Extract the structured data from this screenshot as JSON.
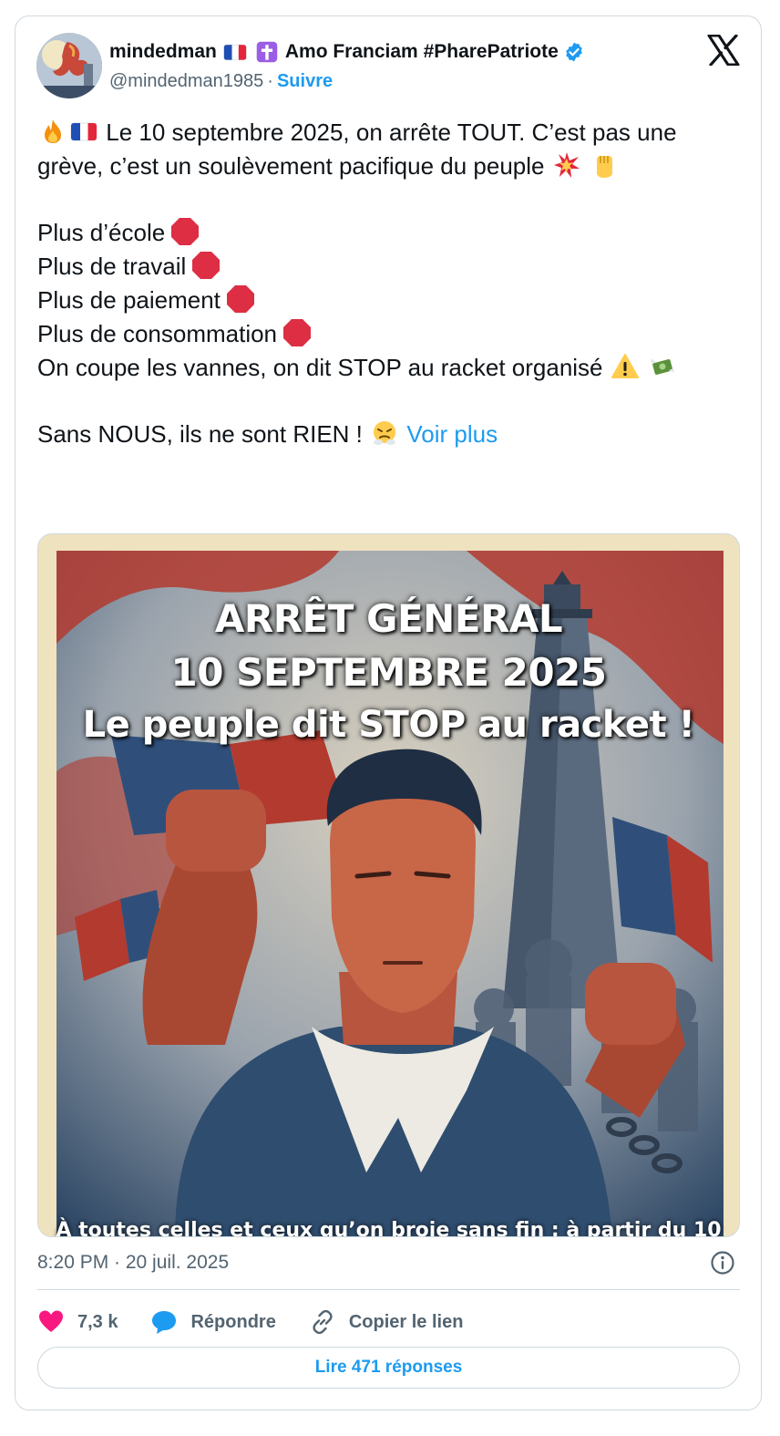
{
  "author": {
    "display_name": "mindedman",
    "display_suffix": "Amo Franciam #PharePatriote",
    "handle": "@mindedman1985",
    "separator": "·",
    "follow_label": "Suivre"
  },
  "tweet": {
    "line1": "Le 10 septembre 2025, on arrête TOUT. C’est pas une grève, c’est un soulèvement pacifique du peuple",
    "items": [
      "Plus d’école",
      "Plus de travail",
      "Plus de paiement",
      "Plus de consommation"
    ],
    "line_stop": "On coupe les vannes, on dit STOP au racket organisé",
    "line_last": "Sans NOUS, ils ne sont RIEN !",
    "more_label": "Voir plus"
  },
  "media": {
    "title_lines": [
      "ARRÊT GÉNÉRAL",
      "10 SEPTEMBRE 2025",
      "Le peuple dit STOP au racket !"
    ],
    "bottom_caption": "À toutes celles et ceux qu’on broie sans fin : à partir du 10"
  },
  "meta": {
    "timestamp": "8:20 PM · 20 juil. 2025"
  },
  "actions": {
    "likes": "7,3 k",
    "reply_label": "Répondre",
    "copy_label": "Copier le lien"
  },
  "replies_button": "Lire 471 réponses",
  "colors": {
    "accent": "#1d9bf0",
    "like": "#f91880",
    "text": "#0f1419",
    "muted": "#536471",
    "border": "#cfd9de"
  },
  "icons": [
    "verified-badge-icon",
    "x-logo-icon",
    "fire-emoji",
    "france-flag-emoji",
    "cross-emoji",
    "collision-emoji",
    "raised-fist-emoji",
    "stop-sign-emoji",
    "warning-emoji",
    "money-wings-emoji",
    "steam-nose-emoji",
    "info-icon",
    "heart-icon",
    "reply-bubble-icon",
    "link-icon"
  ]
}
